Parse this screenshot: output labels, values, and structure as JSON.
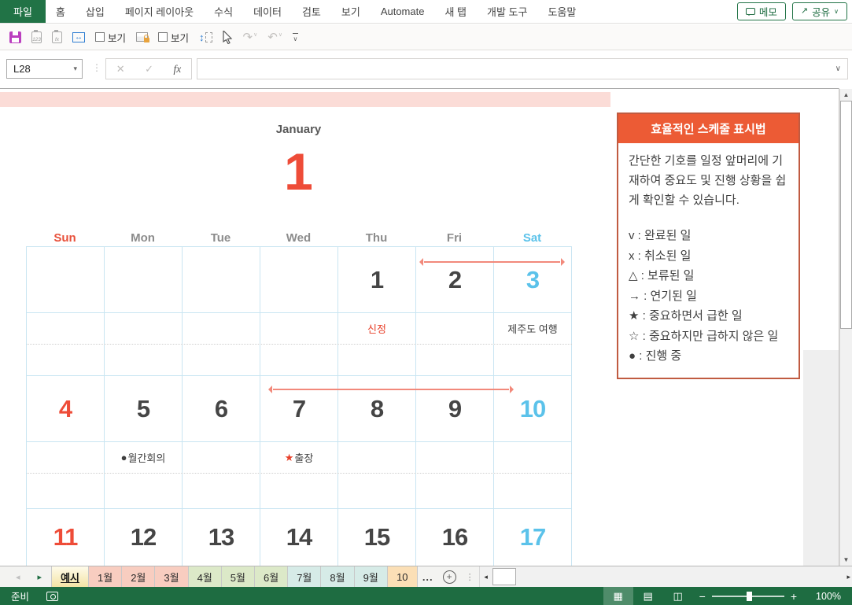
{
  "colors": {
    "excel_green": "#217346",
    "status_bar_green": "#1E6C41",
    "accent_red": "#EE4C38",
    "saturday_blue": "#5BC2EA",
    "grid_blue": "#C9E5F2",
    "pink_band": "#FBDCD7",
    "panel_border": "#C05B41",
    "panel_header_bg": "#EC5B35",
    "save_icon_purple": "#BB3FBF"
  },
  "ribbon": {
    "file_tab": "파일",
    "tabs": [
      "홈",
      "삽입",
      "페이지 레이아웃",
      "수식",
      "데이터",
      "검토",
      "보기",
      "Automate",
      "새 탭",
      "개발 도구",
      "도움말"
    ],
    "memo_button": "메모",
    "share_button": "공유"
  },
  "quick_toolbar": {
    "paste_values_label": "123",
    "paste_formula_label": "fx",
    "view_checkbox_1": "보기",
    "view_checkbox_2": "보기"
  },
  "formula_bar": {
    "name_box": "L28",
    "fx_label": "fx",
    "formula_value": ""
  },
  "glyphs": {
    "dropdown": "▾",
    "chevron_down": "∨",
    "vdots": "⋮",
    "cancel": "✕",
    "enter": "✓",
    "undo": "↶",
    "redo": "↷",
    "h_arrow": "↔",
    "v_arrow": "↕",
    "share_arrow": "↗",
    "nav_left": "◂",
    "nav_right": "▸",
    "scroll_up": "▲",
    "scroll_down": "▼",
    "add": "+",
    "minus": "−",
    "plus": "+",
    "view_normal": "▦",
    "view_layout": "▤",
    "view_break": "◫"
  },
  "calendar": {
    "month_name": "January",
    "month_number": "1",
    "day_headers": [
      "Sun",
      "Mon",
      "Tue",
      "Wed",
      "Thu",
      "Fri",
      "Sat"
    ],
    "weeks": [
      {
        "dates": [
          "",
          "",
          "",
          "",
          "1",
          "2",
          "3"
        ],
        "notes": {
          "4": {
            "symbol": "",
            "text": "신정"
          },
          "6": {
            "symbol": "",
            "text": "제주도 여행"
          }
        }
      },
      {
        "dates": [
          "4",
          "5",
          "6",
          "7",
          "8",
          "9",
          "10"
        ],
        "notes": {
          "1": {
            "symbol": "●",
            "text": "월간회의"
          },
          "3": {
            "symbol": "★",
            "text": "출장"
          }
        }
      },
      {
        "dates": [
          "11",
          "12",
          "13",
          "14",
          "15",
          "16",
          "17"
        ]
      }
    ]
  },
  "panel": {
    "title": "효율적인 스케줄 표시법",
    "description": "간단한 기호를 일정 앞머리에 기재하여 중요도 및 진행 상황을 쉽게 확인할 수 있습니다.",
    "legend": [
      "v : 완료된 일",
      "x : 취소된 일",
      "△ : 보류된 일",
      "→ : 연기된 일",
      "★ : 중요하면서 급한 일",
      "☆ : 중요하지만 급하지 않은 일",
      "● : 진행 중"
    ]
  },
  "sheet_tabs": {
    "tabs": [
      "예시",
      "1월",
      "2월",
      "3월",
      "4월",
      "5월",
      "6월",
      "7월",
      "8월",
      "9월",
      "10"
    ],
    "more_indicator": "..."
  },
  "status_bar": {
    "ready": "준비",
    "zoom_level": "100%"
  }
}
